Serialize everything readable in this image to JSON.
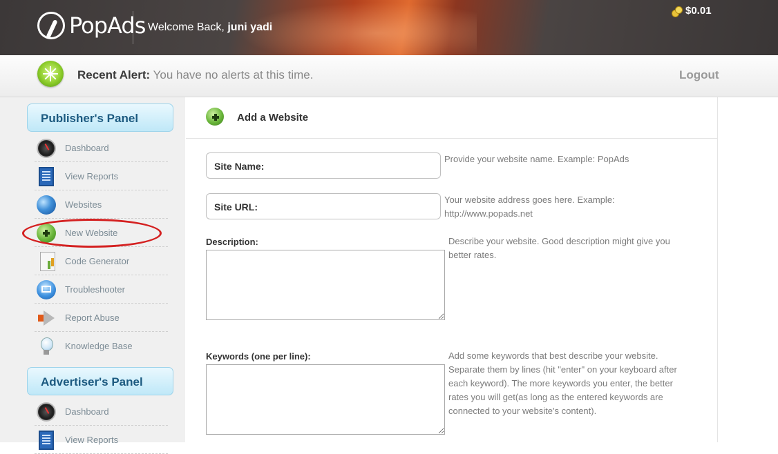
{
  "header": {
    "brand": "PopAds",
    "welcome_prefix": "Welcome Back,",
    "username": "juni yadi",
    "balance": "$0.01"
  },
  "alert_bar": {
    "label": "Recent Alert:",
    "message": "You have no alerts at this time.",
    "logout": "Logout"
  },
  "publisher_panel": {
    "title": "Publisher's Panel",
    "items": [
      {
        "label": "Dashboard",
        "icon": "dashboard-icon"
      },
      {
        "label": "View Reports",
        "icon": "report-icon"
      },
      {
        "label": "Websites",
        "icon": "globe-icon"
      },
      {
        "label": "New Website",
        "icon": "plus-icon"
      },
      {
        "label": "Code Generator",
        "icon": "code-generator-icon"
      },
      {
        "label": "Troubleshooter",
        "icon": "troubleshooter-icon"
      },
      {
        "label": "Report Abuse",
        "icon": "megaphone-icon"
      },
      {
        "label": "Knowledge Base",
        "icon": "lightbulb-icon"
      }
    ]
  },
  "advertiser_panel": {
    "title": "Advertiser's Panel",
    "items": [
      {
        "label": "Dashboard",
        "icon": "dashboard-icon"
      },
      {
        "label": "View Reports",
        "icon": "report-icon"
      }
    ]
  },
  "form": {
    "title": "Add a Website",
    "site_name": {
      "label": "Site Name:",
      "value": "",
      "hint": "Provide your website name. Example: PopAds"
    },
    "site_url": {
      "label": "Site URL:",
      "value": "",
      "hint_line1": "Your website address goes here. Example:",
      "hint_line2": "http://www.popads.net"
    },
    "description": {
      "label": "Description:",
      "value": "",
      "hint_line1": "Describe your website. Good description might give you",
      "hint_line2": "better rates."
    },
    "keywords": {
      "label": "Keywords (one per line):",
      "value": "",
      "hint_lines": [
        "Add some keywords that best describe your website.",
        "Separate them by lines (hit \"enter\" on your keyboard after",
        "each keyword). The more keywords you enter, the better",
        "rates you will get(as long as the entered keywords are",
        "connected to your website's content)."
      ]
    }
  },
  "colors": {
    "panel_heading": "#1c5a80",
    "highlight": "#d42020",
    "alert_green": "#8ccc2a"
  }
}
